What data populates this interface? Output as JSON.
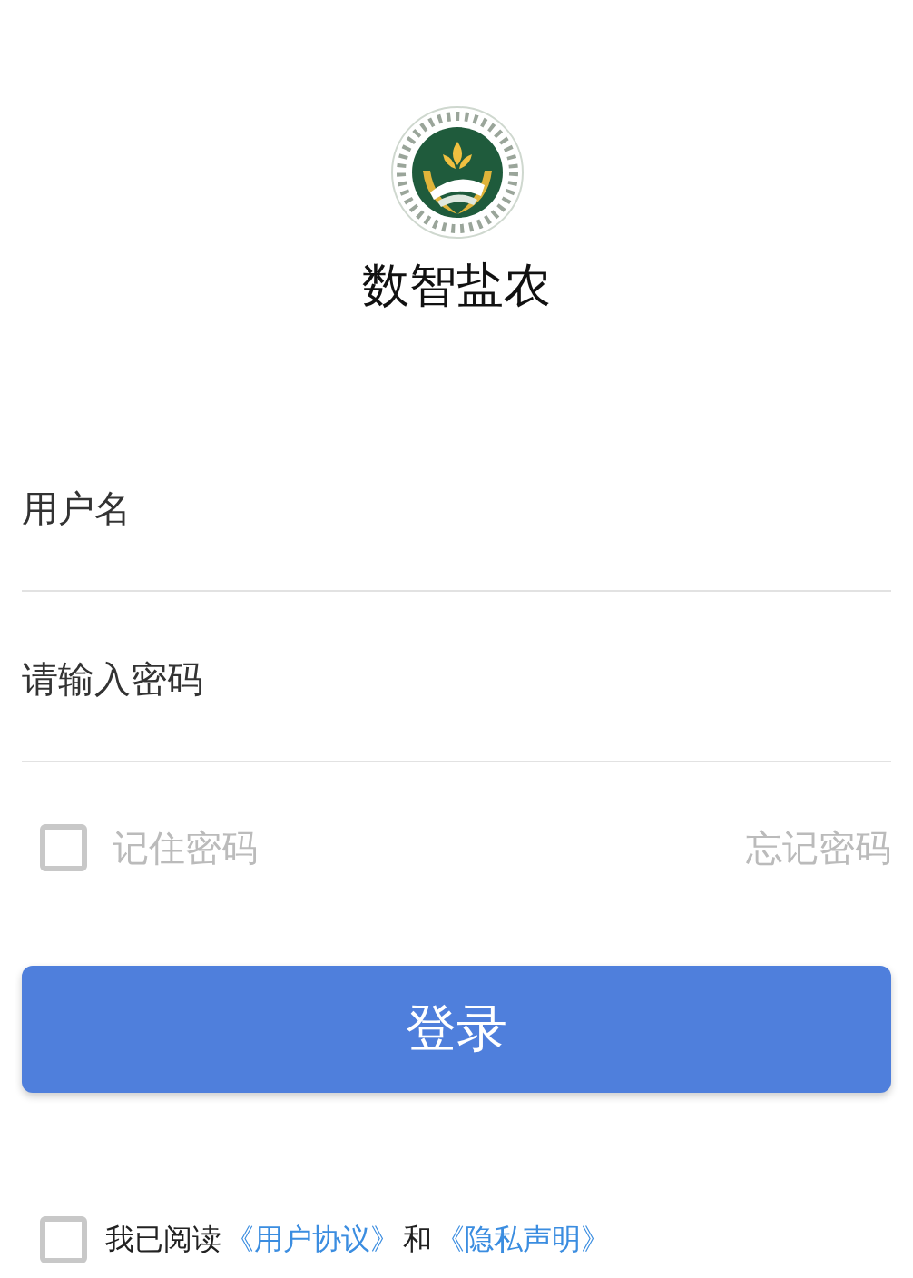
{
  "app_title": "数智盐农",
  "fields": [
    {
      "placeholder": "用户名"
    },
    {
      "placeholder": "请输入密码"
    }
  ],
  "remember": {
    "label": "记住密码",
    "checked": false
  },
  "forgot_link": "忘记密码",
  "login_button": "登录",
  "agreement": {
    "checked": false,
    "parts": [
      {
        "kind": "text",
        "text": "我已阅读"
      },
      {
        "kind": "link",
        "text": "《用户协议》"
      },
      {
        "kind": "text",
        "text": "和"
      },
      {
        "kind": "link",
        "text": "《隐私声明》"
      }
    ]
  }
}
